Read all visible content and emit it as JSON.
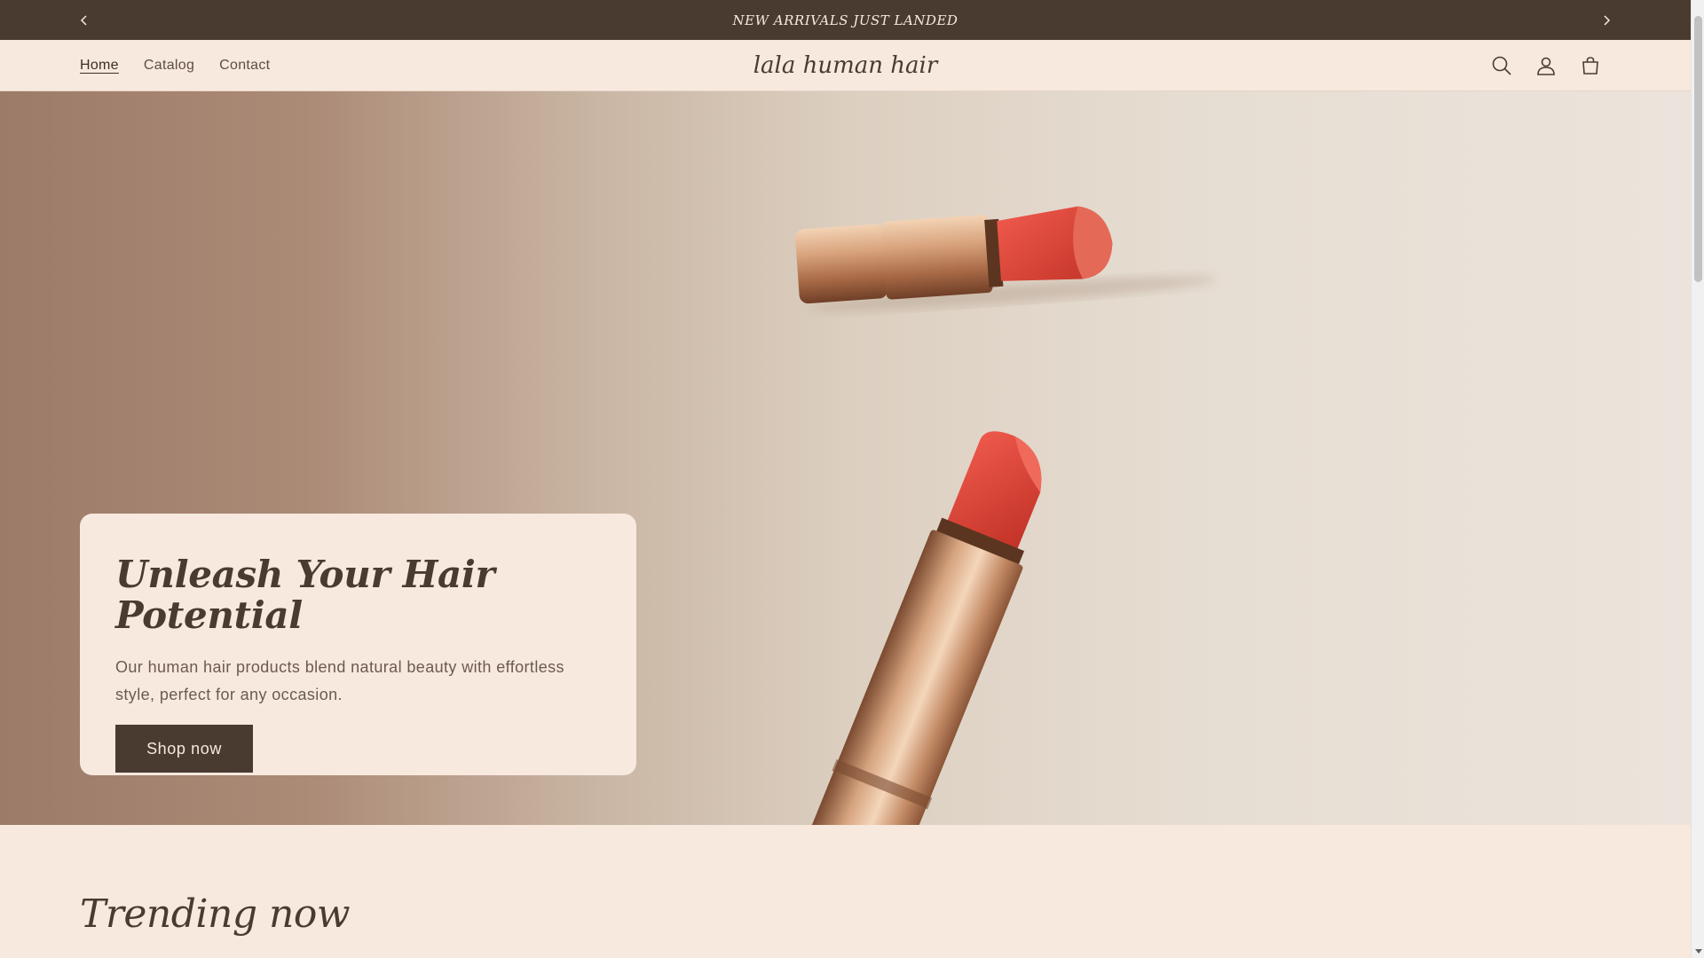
{
  "announcement": {
    "text": "NEW ARRIVALS JUST LANDED",
    "prev_icon": "chevron-left-icon",
    "next_icon": "chevron-right-icon"
  },
  "header": {
    "nav": [
      {
        "label": "Home",
        "active": true
      },
      {
        "label": "Catalog",
        "active": false
      },
      {
        "label": "Contact",
        "active": false
      }
    ],
    "logo": "lala human hair",
    "icons": [
      "search-icon",
      "account-icon",
      "cart-icon"
    ]
  },
  "hero": {
    "title": "Unleash Your Hair Potential",
    "subtitle": "Our human hair products blend natural beauty with effortless style, perfect for any occasion.",
    "button_label": "Shop now",
    "image": "two-red-lipsticks"
  },
  "trending": {
    "title": "Trending now"
  },
  "colors": {
    "primary_dark": "#4a3b31",
    "background": "#f8e9df",
    "lipstick_red": "#e0473d",
    "gold": "#c99a72"
  }
}
